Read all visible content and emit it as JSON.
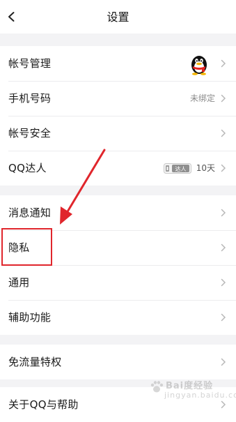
{
  "header": {
    "title": "设置",
    "back_icon": "back-arrow-icon"
  },
  "groups": [
    {
      "items": [
        {
          "label": "帐号管理",
          "accessory": "avatar"
        },
        {
          "label": "手机号码",
          "value": "未绑定"
        },
        {
          "label": "帐号安全"
        },
        {
          "label": "QQ达人",
          "badge_text": "达人",
          "days": "10天"
        }
      ]
    },
    {
      "items": [
        {
          "label": "消息通知"
        },
        {
          "label": "隐私"
        },
        {
          "label": "通用"
        },
        {
          "label": "辅助功能"
        }
      ]
    },
    {
      "items": [
        {
          "label": "免流量特权"
        }
      ]
    },
    {
      "items": [
        {
          "label": "关于QQ与帮助"
        }
      ]
    }
  ],
  "annotation": {
    "highlight_target": "隐私",
    "color": "#e0262c"
  },
  "watermark": {
    "text": "Bai度经验",
    "sub": "jingyan.baidu.com"
  },
  "colors": {
    "background": "#f3f3f5",
    "row": "#ffffff",
    "accent": "#e0262c"
  }
}
